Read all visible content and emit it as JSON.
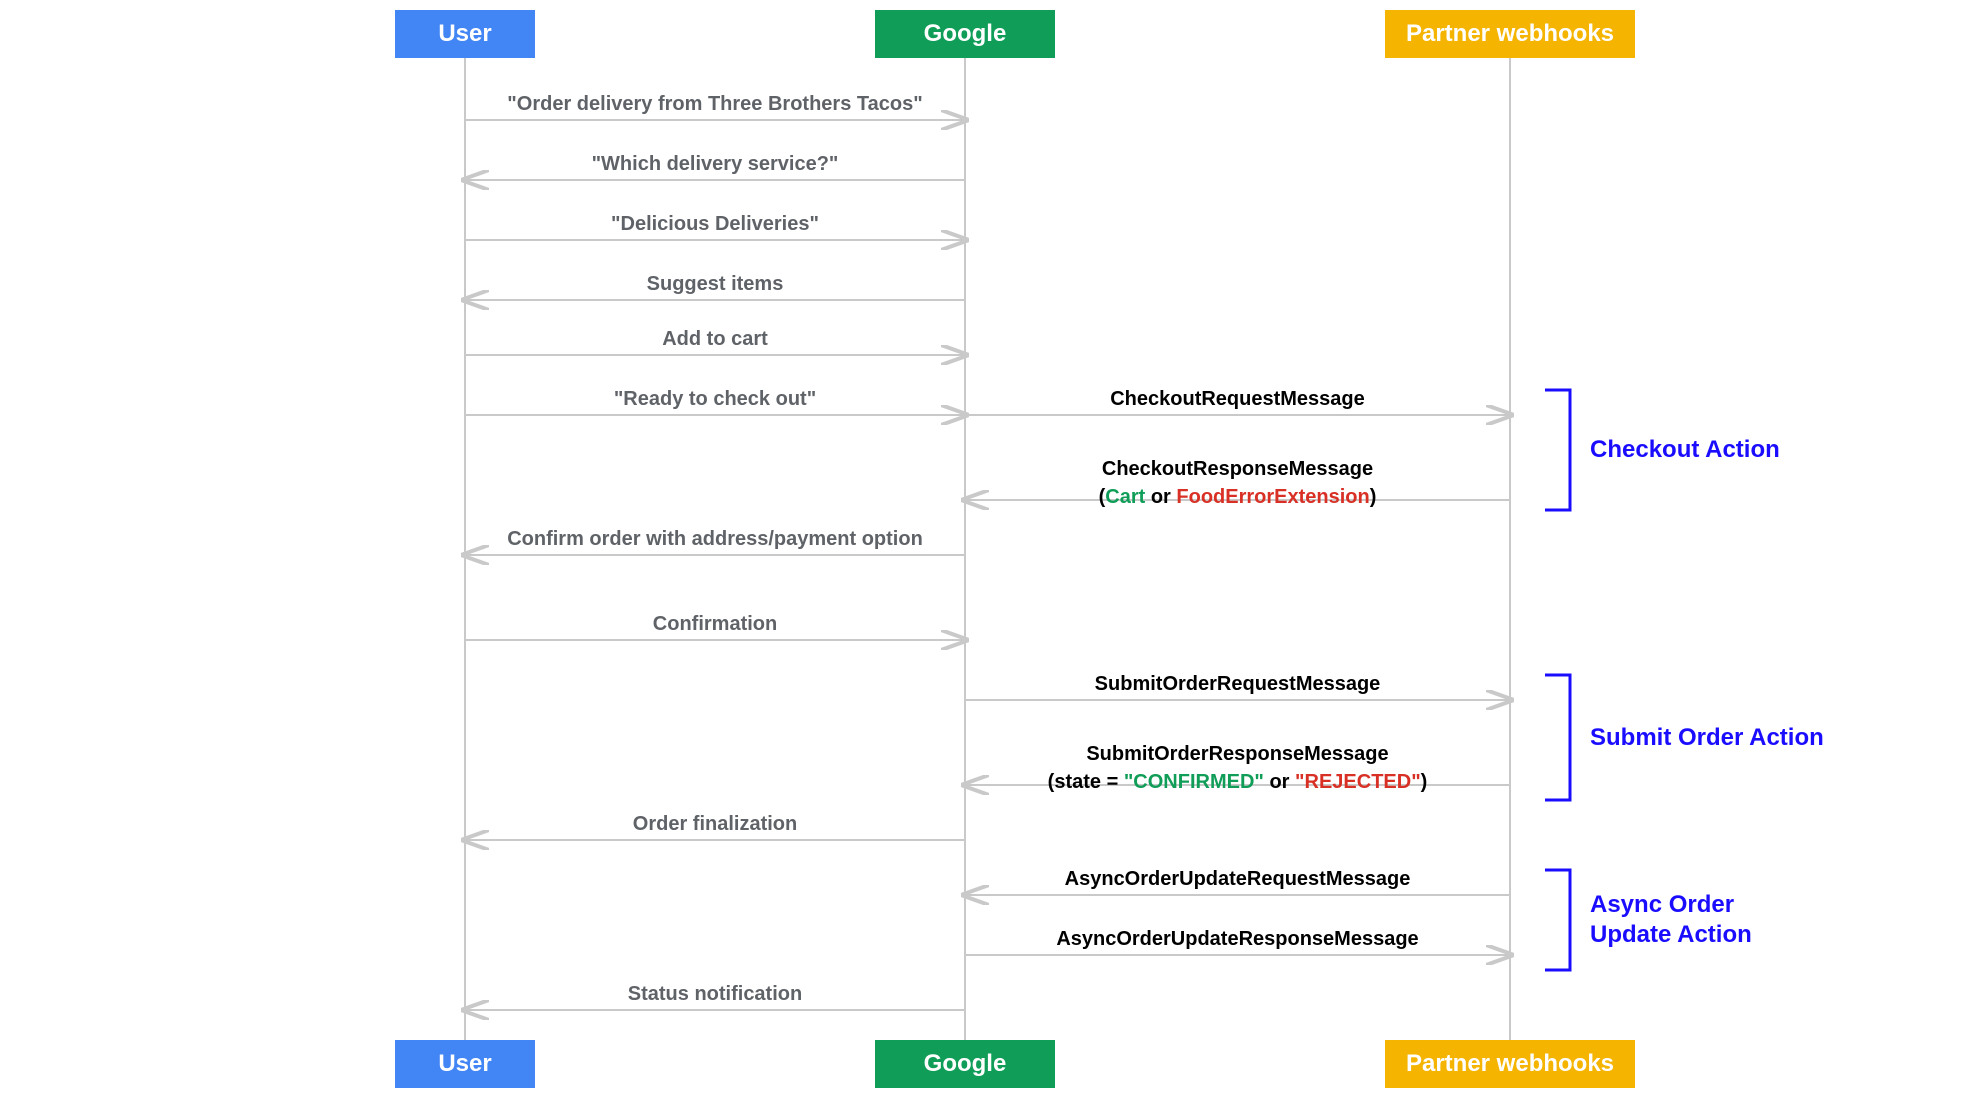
{
  "lanes": {
    "user": "User",
    "google": "Google",
    "partner": "Partner webhooks"
  },
  "messages": {
    "m1": "\"Order delivery from Three Brothers Tacos\"",
    "m2": "\"Which delivery service?\"",
    "m3": "\"Delicious Deliveries\"",
    "m4": "Suggest items",
    "m5": "Add to cart",
    "m6": "\"Ready to check out\"",
    "m7": "CheckoutRequestMessage",
    "m8": "CheckoutResponseMessage",
    "m8sub_open": "(",
    "m8sub_cart": "Cart",
    "m8sub_or": " or ",
    "m8sub_err": "FoodErrorExtension",
    "m8sub_close": ")",
    "m9": "Confirm order with address/payment option",
    "m10": "Confirmation",
    "m11": "SubmitOrderRequestMessage",
    "m12": "SubmitOrderResponseMessage",
    "m12sub_open": "(state = ",
    "m12sub_conf": "\"CONFIRMED\"",
    "m12sub_or": " or ",
    "m12sub_rej": "\"REJECTED\"",
    "m12sub_close": ")",
    "m13": "Order finalization",
    "m14": "AsyncOrderUpdateRequestMessage",
    "m15": "AsyncOrderUpdateResponseMessage",
    "m16": "Status notification"
  },
  "actions": {
    "checkout": "Checkout Action",
    "submit": "Submit Order Action",
    "async": "Async Order\nUpdate Action"
  },
  "chart_data": {
    "type": "sequence-diagram",
    "participants": [
      "User",
      "Google",
      "Partner webhooks"
    ],
    "interactions": [
      {
        "from": "User",
        "to": "Google",
        "label": "\"Order delivery from Three Brothers Tacos\""
      },
      {
        "from": "Google",
        "to": "User",
        "label": "\"Which delivery service?\""
      },
      {
        "from": "User",
        "to": "Google",
        "label": "\"Delicious Deliveries\""
      },
      {
        "from": "Google",
        "to": "User",
        "label": "Suggest items"
      },
      {
        "from": "User",
        "to": "Google",
        "label": "Add to cart"
      },
      {
        "from": "User",
        "to": "Google",
        "label": "\"Ready to check out\""
      },
      {
        "from": "Google",
        "to": "Partner webhooks",
        "label": "CheckoutRequestMessage",
        "group": "Checkout Action"
      },
      {
        "from": "Partner webhooks",
        "to": "Google",
        "label": "CheckoutResponseMessage",
        "note": "(Cart or FoodErrorExtension)",
        "group": "Checkout Action"
      },
      {
        "from": "Google",
        "to": "User",
        "label": "Confirm order with address/payment option"
      },
      {
        "from": "User",
        "to": "Google",
        "label": "Confirmation"
      },
      {
        "from": "Google",
        "to": "Partner webhooks",
        "label": "SubmitOrderRequestMessage",
        "group": "Submit Order Action"
      },
      {
        "from": "Partner webhooks",
        "to": "Google",
        "label": "SubmitOrderResponseMessage",
        "note": "(state = \"CONFIRMED\" or \"REJECTED\")",
        "group": "Submit Order Action"
      },
      {
        "from": "Google",
        "to": "User",
        "label": "Order finalization"
      },
      {
        "from": "Partner webhooks",
        "to": "Google",
        "label": "AsyncOrderUpdateRequestMessage",
        "group": "Async Order Update Action"
      },
      {
        "from": "Google",
        "to": "Partner webhooks",
        "label": "AsyncOrderUpdateResponseMessage",
        "group": "Async Order Update Action"
      },
      {
        "from": "Google",
        "to": "User",
        "label": "Status notification"
      }
    ]
  }
}
